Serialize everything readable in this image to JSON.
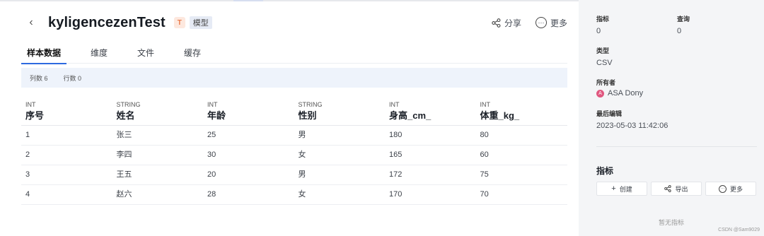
{
  "header": {
    "back_glyph": "‹",
    "title": "kyligencezenTest",
    "table_badge": "T",
    "model_tag": "模型",
    "share_label": "分享",
    "more_label": "更多"
  },
  "tabs": [
    {
      "label": "样本数据",
      "active": true
    },
    {
      "label": "维度",
      "active": false
    },
    {
      "label": "文件",
      "active": false
    },
    {
      "label": "缓存",
      "active": false
    }
  ],
  "stats": {
    "columns": "列数 6",
    "rows": "行数 0"
  },
  "table": {
    "columns": [
      {
        "type": "INT",
        "name": "序号"
      },
      {
        "type": "STRING",
        "name": "姓名"
      },
      {
        "type": "INT",
        "name": "年龄"
      },
      {
        "type": "STRING",
        "name": "性别"
      },
      {
        "type": "INT",
        "name": "身高_cm_"
      },
      {
        "type": "INT",
        "name": "体重_kg_"
      }
    ],
    "rows": [
      [
        "1",
        "张三",
        "25",
        "男",
        "180",
        "80"
      ],
      [
        "2",
        "李四",
        "30",
        "女",
        "165",
        "60"
      ],
      [
        "3",
        "王五",
        "20",
        "男",
        "172",
        "75"
      ],
      [
        "4",
        "赵六",
        "28",
        "女",
        "170",
        "70"
      ]
    ]
  },
  "sidebar": {
    "metrics_label": "指标",
    "metrics_value": "0",
    "queries_label": "查询",
    "queries_value": "0",
    "type_label": "类型",
    "type_value": "CSV",
    "owner_label": "所有者",
    "owner_initial": "A",
    "owner_name": "ASA Dony",
    "edited_label": "最后编辑",
    "edited_value": "2023-05-03 11:42:06",
    "section_title": "指标",
    "create_label": "创建",
    "export_label": "导出",
    "more_label": "更多",
    "empty_text": "暂无指标"
  },
  "watermark": "CSDN @Sam9029",
  "colors": {
    "accent": "#2d6ae0",
    "stats_bg": "#eef3fb",
    "sidebar_bg": "#f4f5f7",
    "badge_orange": "#ea7c4d",
    "avatar_pink": "#e0577f"
  }
}
